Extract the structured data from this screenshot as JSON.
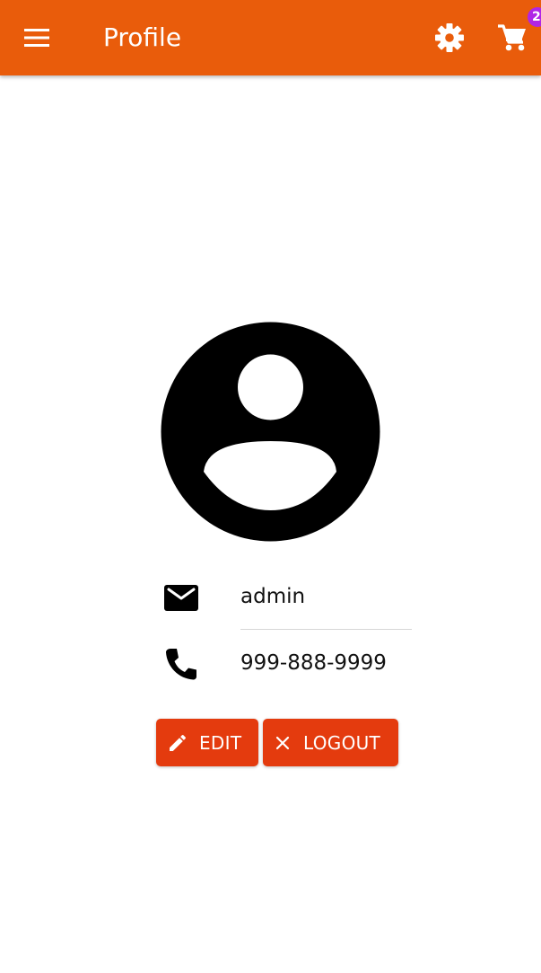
{
  "app_bar": {
    "title": "Profile",
    "menu_icon": "menu-icon",
    "settings_icon": "settings-icon",
    "cart_icon": "shopping-cart-icon",
    "cart_badge_count": "2",
    "background_color": "#e95c0b",
    "badge_color": "#b025e6"
  },
  "profile": {
    "avatar_icon": "account-circle-icon",
    "email_icon": "mail-icon",
    "email": "admin",
    "phone_icon": "phone-icon",
    "phone": "999-888-9999"
  },
  "actions": {
    "edit_icon": "pencil-icon",
    "edit_label": "EDIT",
    "logout_icon": "close-icon",
    "logout_label": "LOGOUT",
    "button_color": "#e43b0e"
  }
}
